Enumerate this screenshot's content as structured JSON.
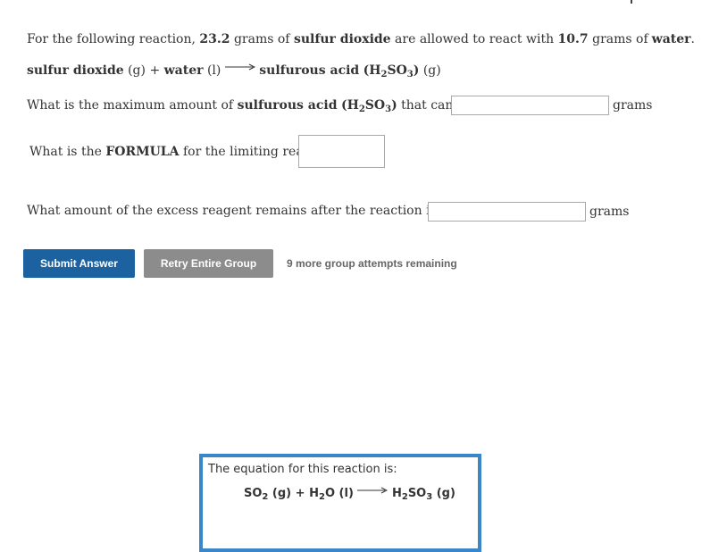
{
  "problem": {
    "intro_prefix": "For the following reaction,",
    "mass1": "23.2",
    "intro_mid1": "grams of",
    "reactant1": "sulfur dioxide",
    "intro_mid2": "are allowed to react with",
    "mass2": "10.7",
    "intro_mid3": "grams of",
    "reactant2": "water",
    "intro_end": "."
  },
  "reaction": {
    "r1": "sulfur dioxide",
    "r1_state": "(g)",
    "plus": "+",
    "r2": "water",
    "r2_state": "(l)",
    "product": "sulfurous acid",
    "product_formula_open": "(H",
    "sub1": "2",
    "product_formula_mid": "SO",
    "sub2": "3",
    "product_formula_close": ")",
    "product_state": "(g)"
  },
  "questions": [
    {
      "pre": "What is the maximum amount of",
      "bold": "sulfurous acid",
      "f_open": "(H",
      "s1": "2",
      "f_mid": "SO",
      "s2": "3",
      "f_close": ")",
      "post": "that can be formed?",
      "value": "",
      "unit": "grams"
    },
    {
      "pre": "What is the",
      "bold": "FORMULA",
      "post": "for the limiting reagent?",
      "value": ""
    },
    {
      "pre": "What amount of the excess reagent remains after the reaction is complete?",
      "value": "",
      "unit": "grams"
    }
  ],
  "actions": {
    "submit_label": "Submit Answer",
    "retry_label": "Retry Entire Group",
    "attempts_text": "9 more group attempts remaining"
  },
  "equation_box": {
    "title": "The equation for this reaction is:",
    "lhs1": "SO",
    "lhs1_sub": "2",
    "lhs1_state": "(g)",
    "plus": "+",
    "lhs2a": "H",
    "lhs2_sub": "2",
    "lhs2b": "O",
    "lhs2_state": "(l)",
    "rhs_a": "H",
    "rhs_sub1": "2",
    "rhs_b": "SO",
    "rhs_sub2": "3",
    "rhs_state": "(g)"
  },
  "colors": {
    "submit_bg": "#1c62a0",
    "retry_bg": "#8c8c8c",
    "box_border": "#3a86c9"
  }
}
